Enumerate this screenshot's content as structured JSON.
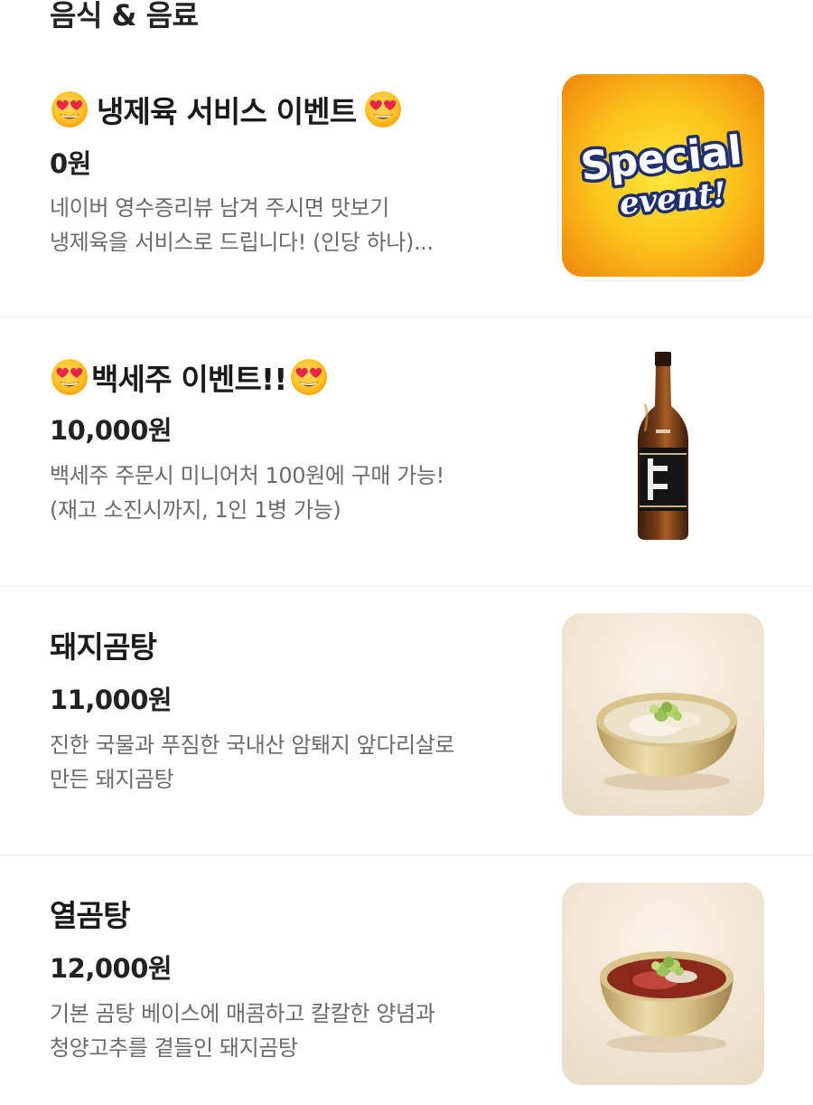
{
  "section": {
    "title": "음식 & 음료"
  },
  "items": [
    {
      "name": "냉제육 서비스 이벤트",
      "price": "0원",
      "desc_line1": "네이버 영수증리뷰 남겨 주시면 맛보기",
      "desc_line2": "냉제육을 서비스로 드립니다! (인당 하나)...",
      "image": "special-event-image",
      "image_text1": "Special",
      "image_text2": "event!"
    },
    {
      "name": "백세주 이벤트!!",
      "price": "10,000원",
      "desc_line1": "백세주 주문시 미니어처 100원에 구매 가능!",
      "desc_line2": "(재고 소진시까지, 1인 1병 가능)",
      "image": "liquor-bottle-image"
    },
    {
      "name": "돼지곰탕",
      "price": "11,000원",
      "desc_line1": "진한 국물과 푸짐한 국내산 암퇘지 앞다리살로",
      "desc_line2": "만든 돼지곰탕",
      "image": "pork-soup-bowl-image"
    },
    {
      "name": "열곰탕",
      "price": "12,000원",
      "desc_line1": "기본 곰탕 베이스에 매콤하고 칼칼한 양념과",
      "desc_line2": "청양고추를 곁들인 돼지곰탕",
      "image": "spicy-soup-bowl-image"
    }
  ],
  "colors": {
    "title": "#1a1a1a",
    "description": "#6b6b6b",
    "divider": "#eeeeee",
    "event_bg": "#f9a70a",
    "bowl_bg": "#f3e7d6"
  }
}
